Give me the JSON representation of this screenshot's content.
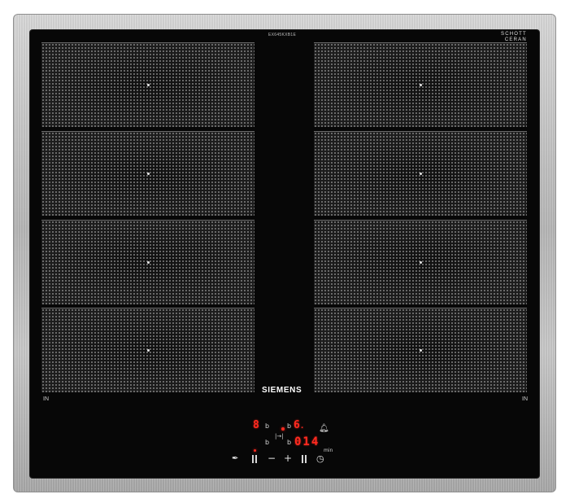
{
  "hob": {
    "model_code": "EX645KXB1E",
    "glass_brand": [
      "SCHOTT",
      "CERAN"
    ],
    "brand": "SIEMENS",
    "zone_label_left": "IN",
    "zone_label_right": "IN"
  },
  "display": {
    "left_level": "8",
    "left_b_top": "b",
    "left_b_bottom": "b",
    "flex_symbol": "|→|",
    "right_b_top": "b",
    "right_level": "6",
    "right_level_suffix": ".",
    "right_b_bottom": "b",
    "timer_value": "014",
    "timer_unit": "min"
  },
  "controls": {
    "key_icon": "child-lock-icon",
    "minus": "−",
    "plus": "+",
    "bell_icon": "bell-icon",
    "clock_icon": "clock-icon"
  },
  "colors": {
    "led": "#ff2a1f",
    "glass": "#070707",
    "frame": "#c0c0c0"
  }
}
